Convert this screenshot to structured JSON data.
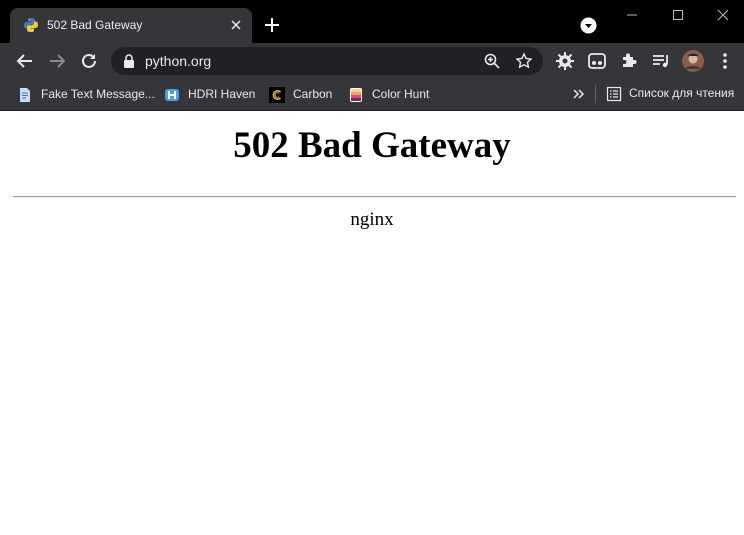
{
  "tab": {
    "title": "502 Bad Gateway",
    "favicon": "python-logo-icon"
  },
  "address_bar": {
    "url": "python.org"
  },
  "bookmarks": [
    {
      "label": "Fake Text Message...",
      "icon": "document-icon"
    },
    {
      "label": "HDRI Haven",
      "icon": "hdri-haven-icon"
    },
    {
      "label": "Carbon",
      "icon": "carbon-icon"
    },
    {
      "label": "Color Hunt",
      "icon": "color-hunt-icon"
    }
  ],
  "reading_list": {
    "label": "Список для чтения"
  },
  "page": {
    "heading": "502 Bad Gateway",
    "server": "nginx"
  },
  "colors": {
    "tabstrip": "#000000",
    "toolbar": "#35363a",
    "omnibox": "#202124",
    "text_light": "#e8eaed",
    "page_bg": "#ffffff"
  }
}
